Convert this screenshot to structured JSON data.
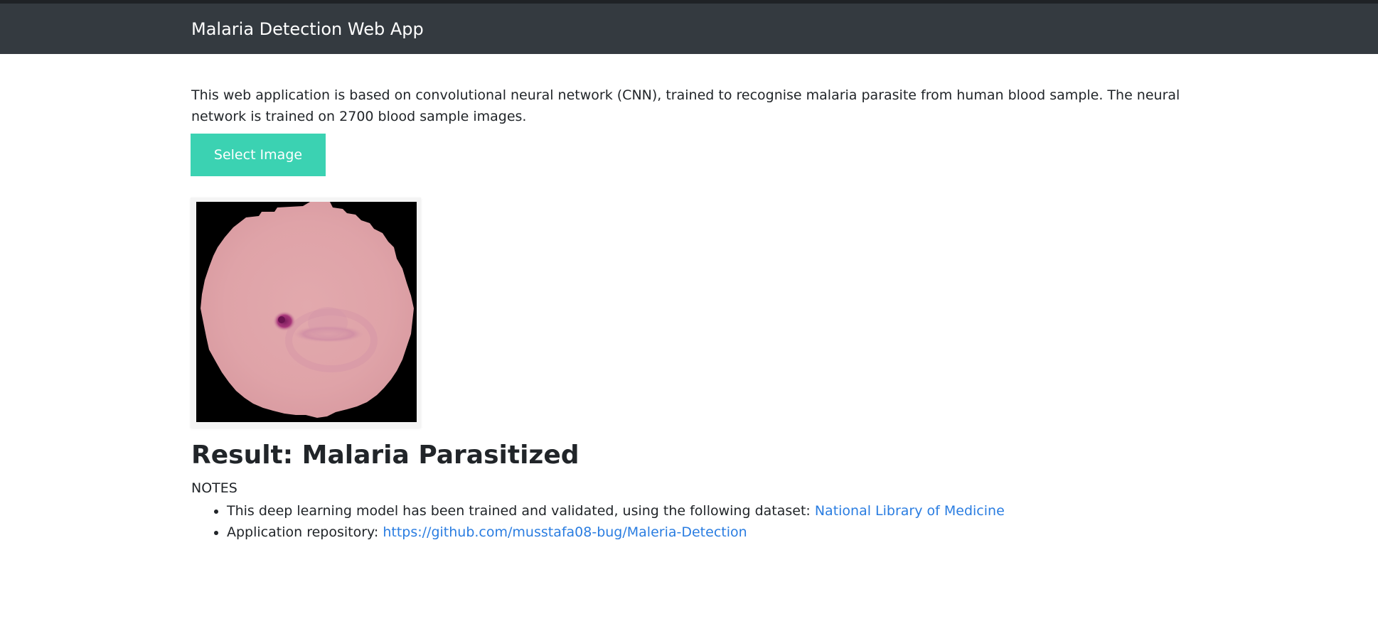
{
  "navbar": {
    "brand": "Malaria Detection Web App"
  },
  "intro": {
    "text": "This web application is based on convolutional neural network (CNN), trained to recognise malaria parasite from human blood sample. The neural network is trained on 2700 blood sample images."
  },
  "upload": {
    "button_label": "Select Image",
    "button_color": "#3bd2b2"
  },
  "preview": {
    "image": "blood-cell-sample"
  },
  "result": {
    "text": "Result: Malaria Parasitized"
  },
  "notes": {
    "label": "NOTES",
    "items": [
      {
        "text": "This deep learning model has been trained and validated, using the following dataset: ",
        "link_text": "National Library of Medicine"
      },
      {
        "text": "Application repository: ",
        "link_text": "https://github.com/musstafa08-bug/Maleria-Detection"
      }
    ]
  },
  "colors": {
    "navbar": "#343a40",
    "link": "#2a7de1",
    "text": "#212529"
  }
}
